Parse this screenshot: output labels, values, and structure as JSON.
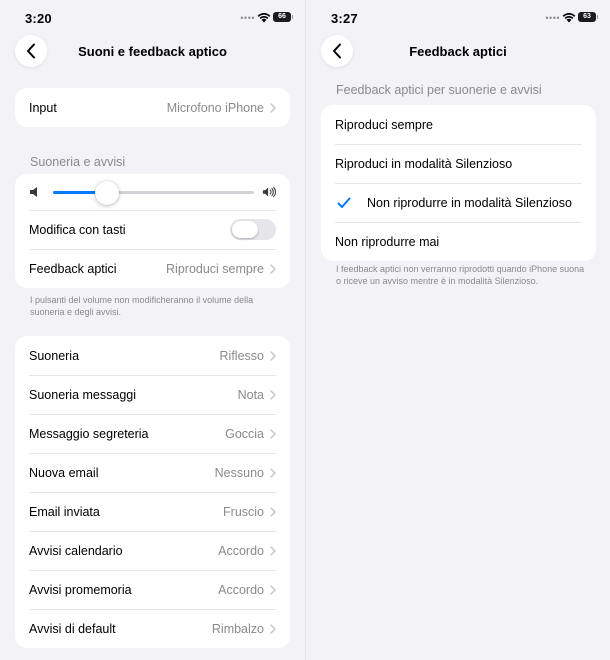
{
  "left": {
    "status": {
      "time": "3:20",
      "battery": "66"
    },
    "nav": {
      "title": "Suoni e feedback aptico"
    },
    "input_row": {
      "label": "Input",
      "value": "Microfono iPhone"
    },
    "ringer_section": {
      "header": "Suoneria e avvisi",
      "volume_level": 0.27,
      "toggle_label": "Modifica con tasti",
      "toggle_on": false,
      "haptic_label": "Feedback aptici",
      "haptic_value": "Riproduci sempre",
      "footnote": "I pulsanti del volume non modificheranno il volume della suoneria e degli avvisi."
    },
    "sounds": [
      {
        "label": "Suoneria",
        "value": "Riflesso"
      },
      {
        "label": "Suoneria messaggi",
        "value": "Nota"
      },
      {
        "label": "Messaggio segreteria",
        "value": "Goccia"
      },
      {
        "label": "Nuova email",
        "value": "Nessuno"
      },
      {
        "label": "Email inviata",
        "value": "Fruscio"
      },
      {
        "label": "Avvisi calendario",
        "value": "Accordo"
      },
      {
        "label": "Avvisi promemoria",
        "value": "Accordo"
      },
      {
        "label": "Avvisi di default",
        "value": "Rimbalzo"
      }
    ]
  },
  "right": {
    "status": {
      "time": "3:27",
      "battery": "63"
    },
    "nav": {
      "title": "Feedback aptici"
    },
    "section_header": "Feedback aptici per suonerie e avvisi",
    "options": [
      {
        "label": "Riproduci sempre",
        "selected": false
      },
      {
        "label": "Riproduci in modalità Silenzioso",
        "selected": false
      },
      {
        "label": "Non riprodurre in modalità Silenzioso",
        "selected": true
      },
      {
        "label": "Non riprodurre mai",
        "selected": false
      }
    ],
    "footnote": "I feedback aptici non verranno riprodotti quando iPhone suona o riceve un avviso mentre è in modalità Silenzioso."
  },
  "colors": {
    "accent": "#007aff",
    "background": "#f2f2f7",
    "secondary_text": "#8a8a8e"
  }
}
